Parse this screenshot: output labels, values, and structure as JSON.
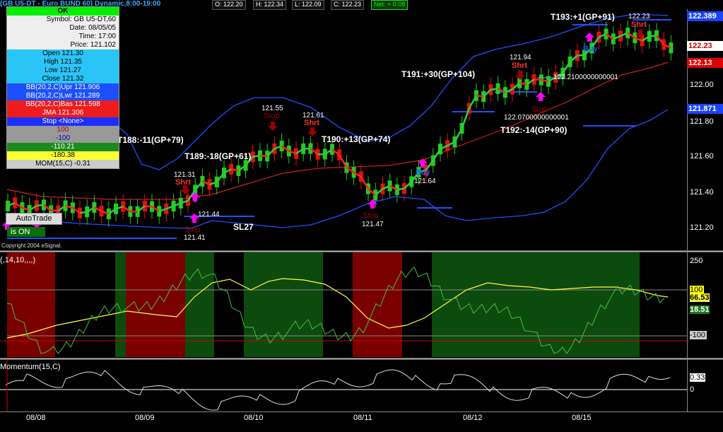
{
  "header": {
    "title": "(GB U5-DT - Euro BUND 60) Dynamic,8:00-19:00",
    "open": "O: 122.20",
    "high": "H: 122.34",
    "low": "L: 122.09",
    "close": "C: 122.23",
    "net": "Net: + 0.08"
  },
  "data_window": {
    "ok_label": "OK",
    "symbol": "Symbol: GB U5-DT,60",
    "date": "Date: 08/05/05",
    "time": "Time: 17:00",
    "price": "Price: 121.102",
    "open": "Open 121.30",
    "high": "High 121.35",
    "low": "Low 121.27",
    "close": "Close 121.32",
    "bb_upr": "BB(20,2,C)Upr 121.906",
    "bb_lwr": "BB(20,2,C)Lwr 121.289",
    "bb_bas": "BB(20,2,C)Bas 121.598",
    "jma": "JMA 121.306",
    "stop": "Stop <None>",
    "v100": "100",
    "vm100": "-100",
    "v11021": "-110.21",
    "v18038": "-180.38",
    "mom": "MOM(15,C) -0.31"
  },
  "autotrade": {
    "button": "AutoTrade",
    "status": "is ON"
  },
  "copyright": "Copyright 2004 eSignal.",
  "indicator_label": "(,14,10,,,,)",
  "momentum_label": "Momentum(15,C)",
  "price_labels": {
    "top": "122.389",
    "last": "122.23",
    "second": "122.13",
    "lower": "121.871"
  },
  "price_axis": [
    "122.00",
    "121.80",
    "121.60",
    "121.40",
    "121.20"
  ],
  "indicator_axis": {
    "top": "250",
    "hundred": "100",
    "value1": "66.53",
    "value2": "18.51",
    "minus100": "-100"
  },
  "momentum_axis": {
    "value": "0.33",
    "zero": "0"
  },
  "x_axis": [
    "08/08",
    "08/09",
    "08/10",
    "08/11",
    "08/12",
    "08/15"
  ],
  "annotations": {
    "t188": "T188:-11(GP+79)",
    "t189": "T189:-18(GP+61)",
    "t190": "T190:+13(GP+74)",
    "t191": "T191:+30(GP+104)",
    "t192": "T192:-14(GP+90)",
    "t193": "T193:+1(GP+91)",
    "sl27": "SL27",
    "stop": "Stop",
    "shrt": "Shrt",
    "buy": "Buy",
    "p12131": "121.31",
    "p12144": "121.44",
    "p12141": "121.41",
    "p12155": "121.55",
    "p12161": "121.61",
    "p12147": "121.47",
    "p12164": "121.64",
    "p12194": "121.94",
    "p1222100": "122.2100000000001",
    "p1220700": "122.0700000000001",
    "p12223": "122.23"
  },
  "colors": {
    "bb_band": "#1e50ff",
    "jma_green": "#2ecc40",
    "jma_red": "#ff2020",
    "basis": "#d02020",
    "stop_line": "#1e50ff",
    "up_candle": "#22cc22",
    "down_candle": "#dd1111",
    "shrt_text": "#ff3030",
    "buy_arrow": "#ff00ff",
    "stop_arrow": "#990000",
    "zone_red": "#7a0000",
    "zone_green": "#0d4a0d",
    "yellow": "#ffff33"
  }
}
